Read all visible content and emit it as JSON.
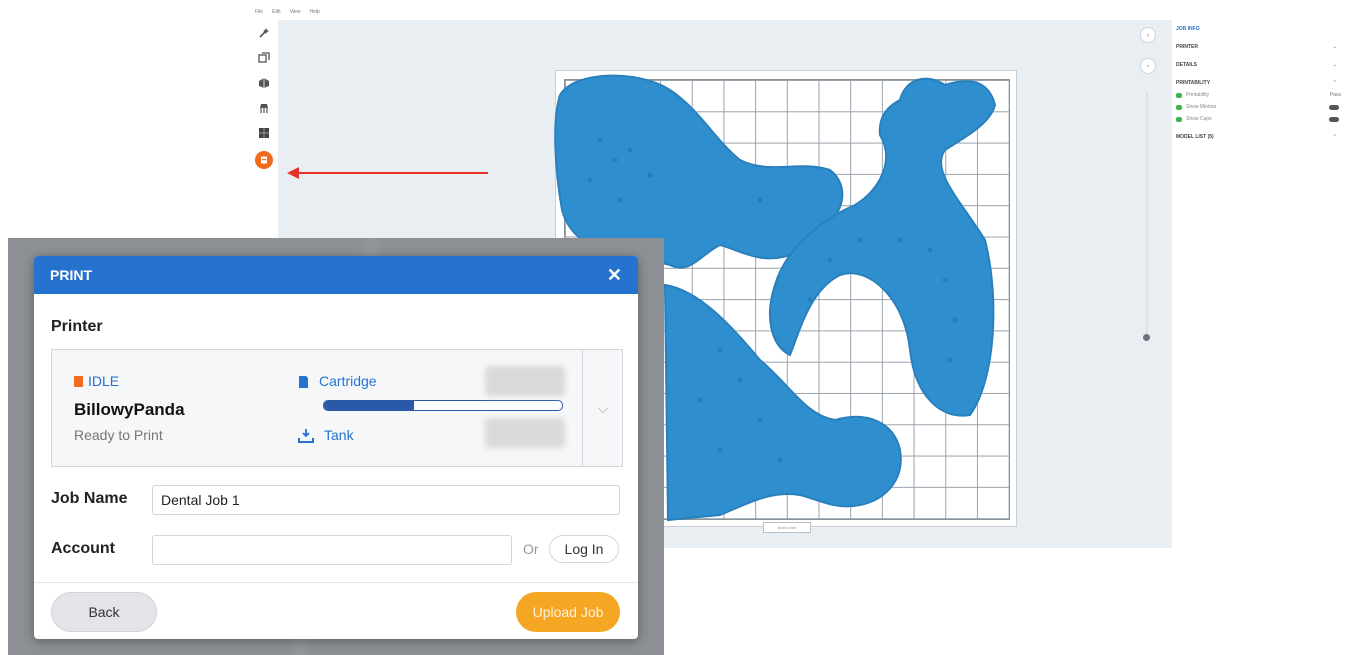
{
  "app": {
    "menu": [
      "File",
      "Edit",
      "View",
      "Help"
    ],
    "tools": [
      {
        "icon": "magic-wand-icon"
      },
      {
        "icon": "layout-icon"
      },
      {
        "icon": "orient-icon"
      },
      {
        "icon": "supports-icon"
      },
      {
        "icon": "grid-icon"
      },
      {
        "icon": "print-icon"
      }
    ],
    "plate_label": "Build plate",
    "right_panel": {
      "title": "JOB INFO",
      "sections": [
        {
          "label": "PRINTER",
          "chevron": "⌄"
        },
        {
          "label": "DETAILS",
          "chevron": "⌄"
        },
        {
          "label": "PRINTABILITY",
          "chevron": "⌃"
        }
      ],
      "checks": [
        {
          "label": "Printability",
          "value": "Pass",
          "kind": "value"
        },
        {
          "label": "Show Minima",
          "kind": "toggle"
        },
        {
          "label": "Show Cups",
          "kind": "toggle"
        }
      ],
      "model_list": {
        "label": "MODEL LIST (5)",
        "chevron": "⌃"
      }
    }
  },
  "dialog": {
    "title": "PRINT",
    "close_glyph": "✕",
    "printer_section": "Printer",
    "printer": {
      "status": "IDLE",
      "name": "BillowyPanda",
      "state": "Ready to Print",
      "cartridge_label": "Cartridge",
      "cartridge_fill": 0.38,
      "tank_label": "Tank",
      "expand_glyph": "⌵"
    },
    "job_name": {
      "label": "Job Name",
      "value": "Dental Job 1"
    },
    "account": {
      "label": "Account",
      "value": "",
      "or_label": "Or",
      "login_label": "Log In"
    },
    "back_label": "Back",
    "upload_label": "Upload Job"
  },
  "colors": {
    "header_blue": "#2672cf",
    "accent_orange": "#f26b1d",
    "upload_orange": "#f5a623",
    "model_blue": "#2f8fce",
    "arrow_red": "#e8302a"
  }
}
